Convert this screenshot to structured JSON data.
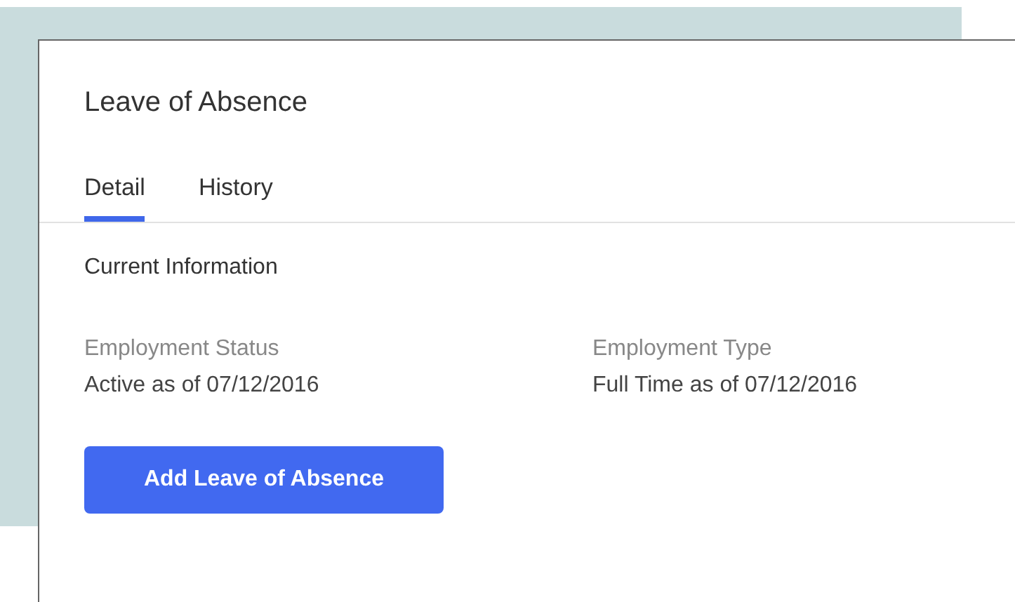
{
  "title": "Leave of Absence",
  "tabs": [
    {
      "label": "Detail",
      "selected": true
    },
    {
      "label": "History",
      "selected": false
    }
  ],
  "section_title": "Current Information",
  "fields": [
    {
      "label": "Employment Status",
      "value": "Active as of 07/12/2016"
    },
    {
      "label": "Employment Type",
      "value": "Full Time as of 07/12/2016"
    }
  ],
  "button": "Add Leave of Absence"
}
